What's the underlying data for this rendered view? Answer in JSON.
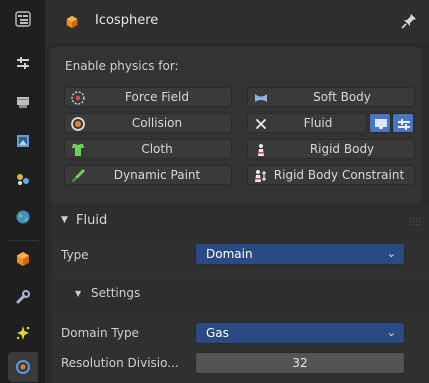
{
  "header": {
    "title": "Icosphere",
    "object_icon": "object-cube-icon",
    "pin_icon": "pin-icon"
  },
  "tabs": [
    {
      "icon": "tool-icon",
      "active": false
    },
    {
      "icon": "render-icon",
      "active": false
    },
    {
      "icon": "output-icon",
      "active": false
    },
    {
      "icon": "view-layer-icon",
      "active": false
    },
    {
      "icon": "scene-icon",
      "active": false
    },
    {
      "icon": "world-icon",
      "active": false
    },
    {
      "icon": "object-icon",
      "active": false
    },
    {
      "icon": "modifier-wrench-icon",
      "active": false
    },
    {
      "icon": "particles-icon",
      "active": false
    },
    {
      "icon": "physics-icon",
      "active": true
    }
  ],
  "physics": {
    "label": "Enable physics for:",
    "buttons": {
      "force_field": "Force Field",
      "collision": "Collision",
      "cloth": "Cloth",
      "dynamic_paint": "Dynamic Paint",
      "soft_body": "Soft Body",
      "fluid": "Fluid",
      "rigid_body": "Rigid Body",
      "rigid_body_constraint": "Rigid Body Constraint"
    }
  },
  "fluid": {
    "section_title": "Fluid",
    "type_label": "Type",
    "type_value": "Domain",
    "settings_title": "Settings",
    "domain_type_label": "Domain Type",
    "domain_type_value": "Gas",
    "resolution_label": "Resolution Divisio...",
    "resolution_value": "32"
  },
  "colors": {
    "accent_blue": "#2a4a84",
    "panel_bg": "#333333",
    "tab_bg": "#1f1f1f"
  }
}
